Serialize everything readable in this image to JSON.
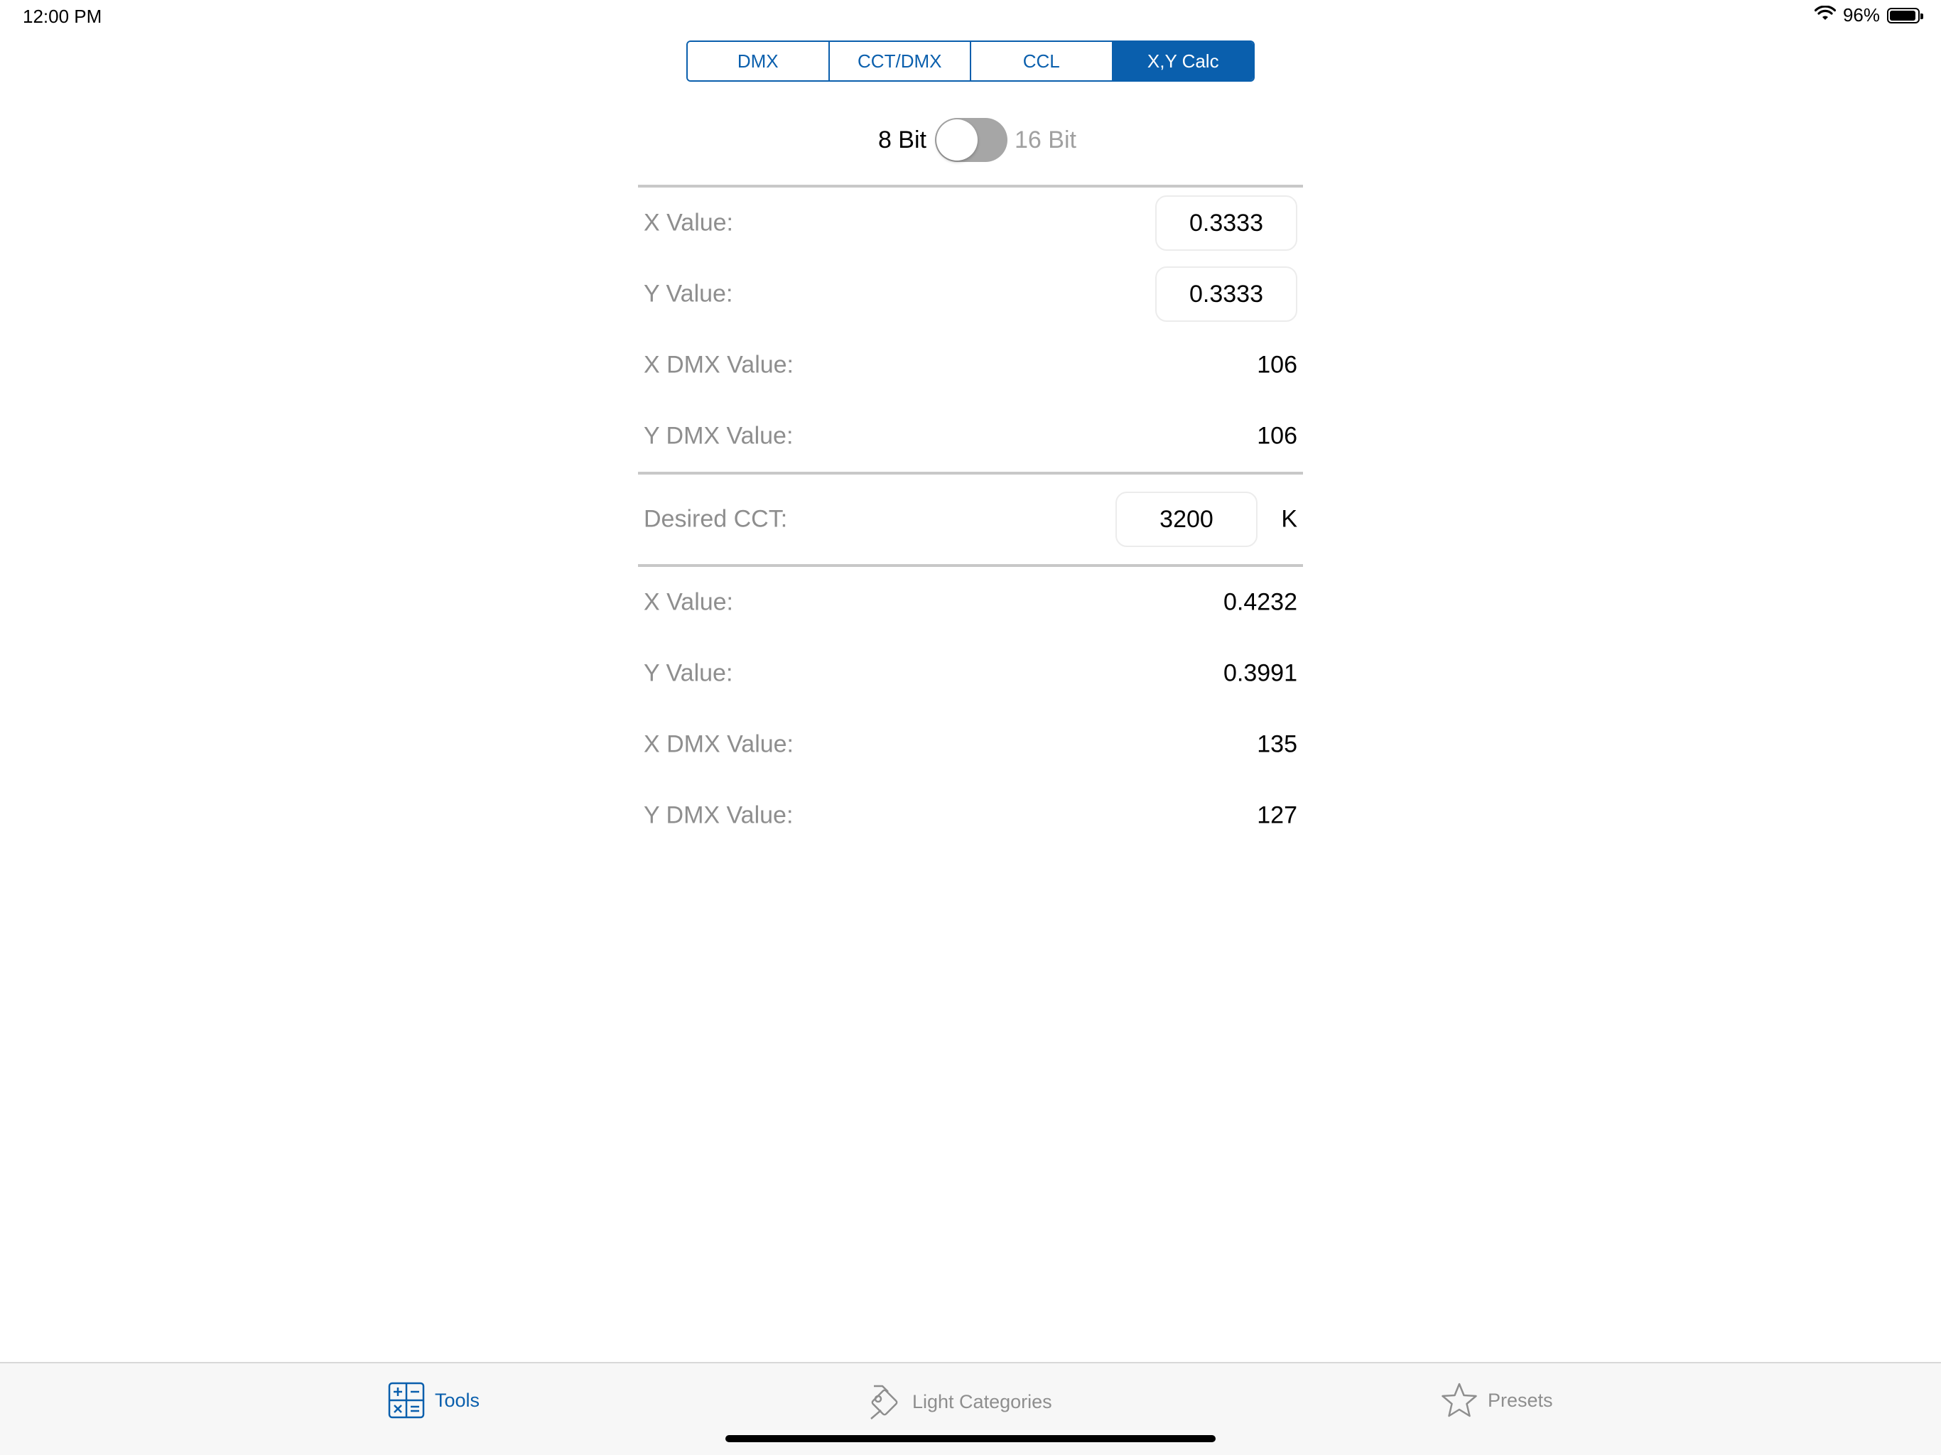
{
  "status_bar": {
    "time": "12:00 PM",
    "battery_percent": "96%",
    "battery_level": 0.96
  },
  "segments": [
    {
      "label": "DMX",
      "active": false
    },
    {
      "label": "CCT/DMX",
      "active": false
    },
    {
      "label": "CCL",
      "active": false
    },
    {
      "label": "X,Y Calc",
      "active": true
    }
  ],
  "bit_toggle": {
    "left_label": "8 Bit",
    "right_label": "16 Bit",
    "is_on": false
  },
  "input_section": {
    "x_value_label": "X Value:",
    "x_value": "0.3333",
    "y_value_label": "Y Value:",
    "y_value": "0.3333",
    "x_dmx_label": "X DMX Value:",
    "x_dmx_value": "106",
    "y_dmx_label": "Y DMX Value:",
    "y_dmx_value": "106"
  },
  "cct_section": {
    "label": "Desired CCT:",
    "value": "3200",
    "unit": "K"
  },
  "result_section": {
    "x_value_label": "X Value:",
    "x_value": "0.4232",
    "y_value_label": "Y Value:",
    "y_value": "0.3991",
    "x_dmx_label": "X DMX Value:",
    "x_dmx_value": "135",
    "y_dmx_label": "Y DMX Value:",
    "y_dmx_value": "127"
  },
  "tab_bar": {
    "tools": {
      "label": "Tools",
      "icon": "calculator-icon",
      "active": true
    },
    "light_categories": {
      "label": "Light Categories",
      "icon": "light-fixture-icon",
      "active": false
    },
    "presets": {
      "label": "Presets",
      "icon": "star-icon",
      "active": false
    }
  },
  "colors": {
    "accent": "#0a5fad",
    "label_gray": "#8e8e8e",
    "toggle_off": "#a6a6a6",
    "tab_bar_bg": "#f7f7f7"
  }
}
